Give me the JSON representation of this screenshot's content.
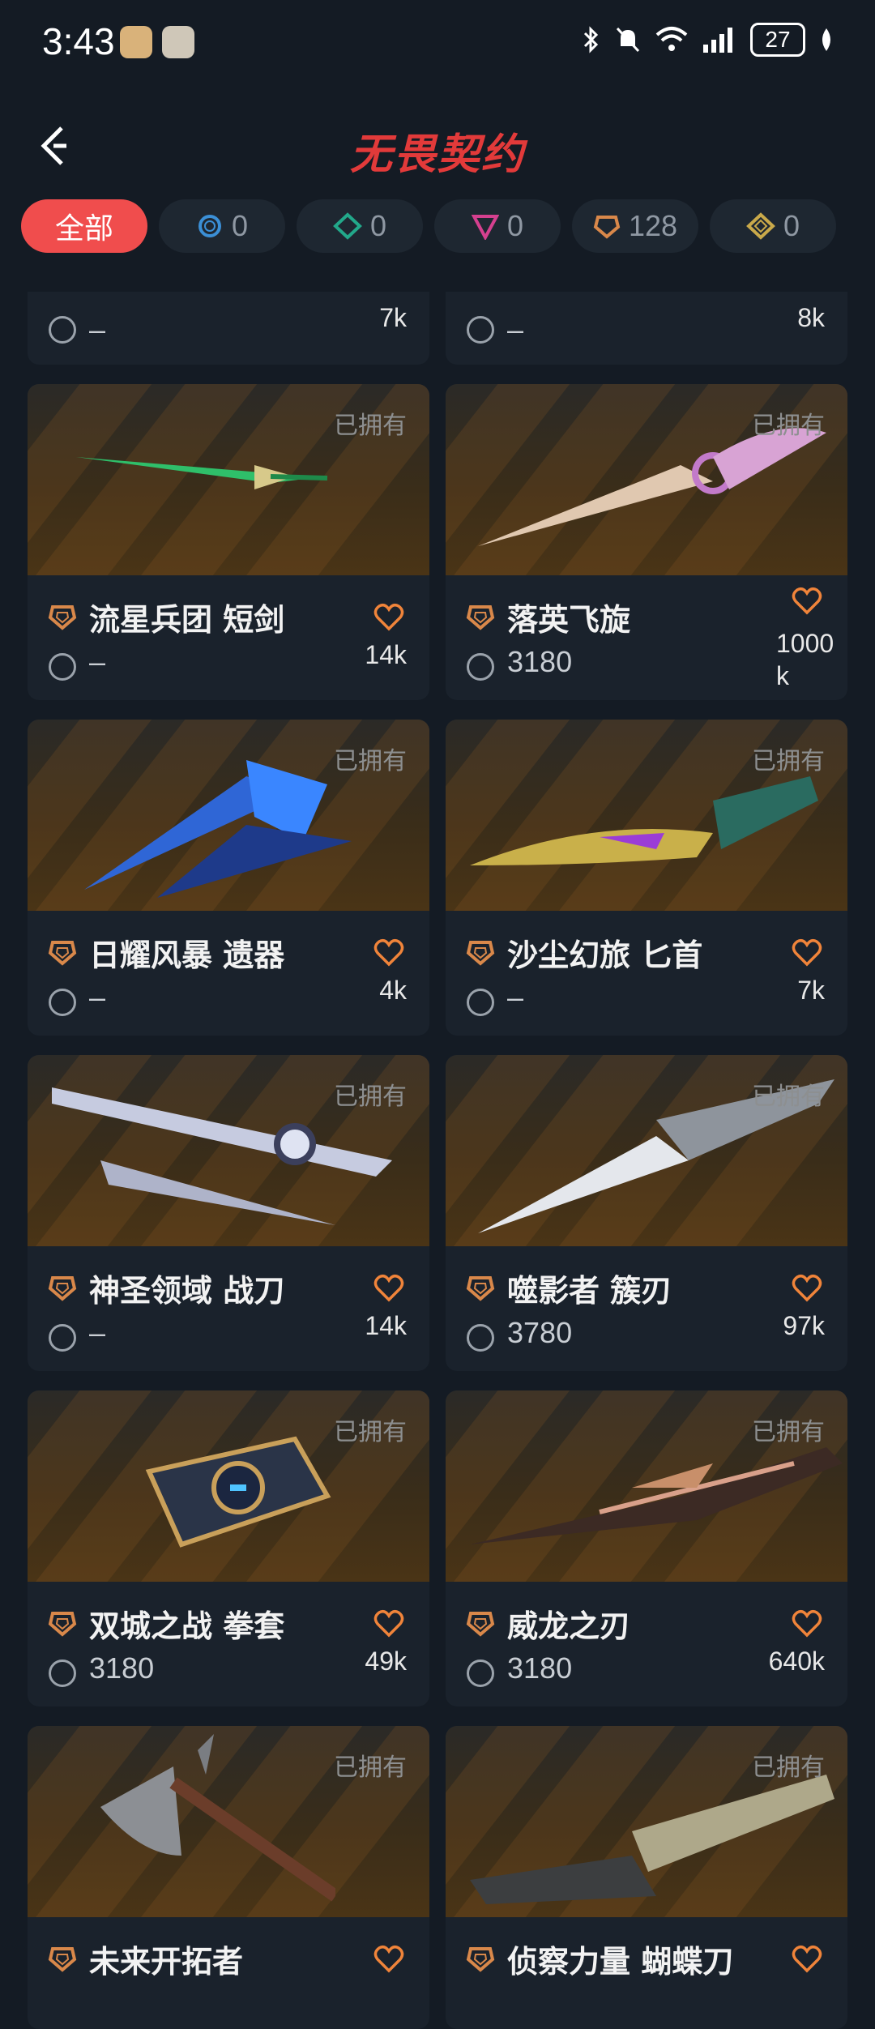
{
  "status_bar": {
    "time": "3:43",
    "battery": "27"
  },
  "header": {
    "title": "无畏契约"
  },
  "tabs": [
    {
      "label": "全部",
      "active": true
    },
    {
      "count": "0",
      "icon": "blue-ring-icon",
      "color": "#3b8fd6"
    },
    {
      "count": "0",
      "icon": "teal-diamond-icon",
      "color": "#22a88a"
    },
    {
      "count": "0",
      "icon": "pink-triangle-icon",
      "color": "#d5408f"
    },
    {
      "count": "128",
      "icon": "orange-pentagon-icon",
      "color": "#d9884a"
    },
    {
      "count": "0",
      "icon": "gold-diamond-icon",
      "color": "#c9a94a"
    }
  ],
  "partial_top": [
    {
      "price": "–",
      "likes": "7k"
    },
    {
      "price": "–",
      "likes": "8k"
    }
  ],
  "cards": [
    {
      "name": "流星兵团 短剑",
      "owned": "已拥有",
      "price": "–",
      "likes": "14k"
    },
    {
      "name": "落英飞旋",
      "owned": "已拥有",
      "price": "3180",
      "likes": "1000\nk"
    },
    {
      "name": "日耀风暴 遗器",
      "owned": "已拥有",
      "price": "–",
      "likes": "4k"
    },
    {
      "name": "沙尘幻旅 匕首",
      "owned": "已拥有",
      "price": "–",
      "likes": "7k"
    },
    {
      "name": "神圣领域 战刀",
      "owned": "已拥有",
      "price": "–",
      "likes": "14k"
    },
    {
      "name": "噬影者 簇刃",
      "owned": "已拥有",
      "price": "3780",
      "likes": "97k"
    },
    {
      "name": "双城之战 拳套",
      "owned": "已拥有",
      "price": "3180",
      "likes": "49k"
    },
    {
      "name": "威龙之刃",
      "owned": "已拥有",
      "price": "3180",
      "likes": "640k"
    },
    {
      "name": "未来开拓者",
      "owned": "已拥有",
      "price": "",
      "likes": ""
    },
    {
      "name": "侦察力量 蝴蝶刀",
      "owned": "已拥有",
      "price": "",
      "likes": ""
    }
  ]
}
